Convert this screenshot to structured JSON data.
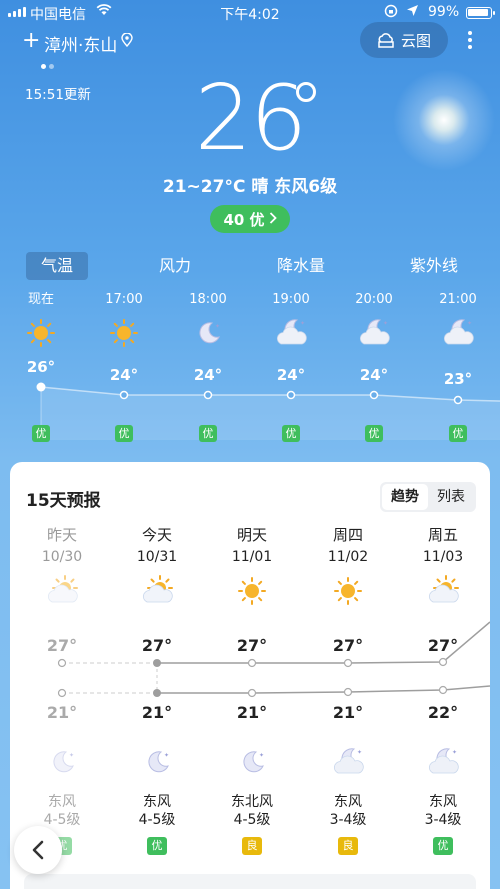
{
  "status": {
    "carrier": "中国电信",
    "time": "下午4:02",
    "battery": "99%"
  },
  "header": {
    "city": "漳州·东山",
    "cloud_map": "云图",
    "updated": "15:51更新"
  },
  "current": {
    "temp": "26",
    "summary": "21~27°C 晴 东风6级",
    "aqi": "40 优"
  },
  "tabs": [
    "气温",
    "风力",
    "降水量",
    "紫外线"
  ],
  "hourly": [
    {
      "time": "现在",
      "temp": "26°",
      "icon": "sun-icon",
      "aq": "优"
    },
    {
      "time": "17:00",
      "temp": "24°",
      "icon": "sun-icon",
      "aq": "优"
    },
    {
      "time": "18:00",
      "temp": "24°",
      "icon": "moon-icon",
      "aq": "优"
    },
    {
      "time": "19:00",
      "temp": "24°",
      "icon": "moon-cloud-icon",
      "aq": "优"
    },
    {
      "time": "20:00",
      "temp": "24°",
      "icon": "moon-cloud-icon",
      "aq": "优"
    },
    {
      "time": "21:00",
      "temp": "23°",
      "icon": "moon-cloud-icon",
      "aq": "优"
    }
  ],
  "forecast": {
    "title": "15天预报",
    "view_trend": "趋势",
    "view_list": "列表",
    "days": [
      {
        "name": "昨天",
        "date": "10/30",
        "day_icon": "sun-cloud-icon",
        "hi": "27°",
        "lo": "21°",
        "night_icon": "moon-icon",
        "wind_dir": "东风",
        "wind_lvl": "4-5级",
        "aq": "优",
        "aq_color": "#3fbe5d"
      },
      {
        "name": "今天",
        "date": "10/31",
        "day_icon": "sun-cloud-icon",
        "hi": "27°",
        "lo": "21°",
        "night_icon": "moon-icon",
        "wind_dir": "东风",
        "wind_lvl": "4-5级",
        "aq": "优",
        "aq_color": "#3fbe5d"
      },
      {
        "name": "明天",
        "date": "11/01",
        "day_icon": "sun-icon",
        "hi": "27°",
        "lo": "21°",
        "night_icon": "moon-icon",
        "wind_dir": "东北风",
        "wind_lvl": "4-5级",
        "aq": "良",
        "aq_color": "#e8b90c"
      },
      {
        "name": "周四",
        "date": "11/02",
        "day_icon": "sun-icon",
        "hi": "27°",
        "lo": "21°",
        "night_icon": "moon-cloud-icon",
        "wind_dir": "东风",
        "wind_lvl": "3-4级",
        "aq": "良",
        "aq_color": "#e8b90c"
      },
      {
        "name": "周五",
        "date": "11/03",
        "day_icon": "sun-cloud-icon",
        "hi": "27°",
        "lo": "22°",
        "night_icon": "moon-cloud-icon",
        "wind_dir": "东风",
        "wind_lvl": "3-4级",
        "aq": "优",
        "aq_color": "#3fbe5d"
      }
    ]
  },
  "colors": {
    "good": "#3fbe5d",
    "moderate": "#e8b90c",
    "accent": "#3f8fe0"
  }
}
